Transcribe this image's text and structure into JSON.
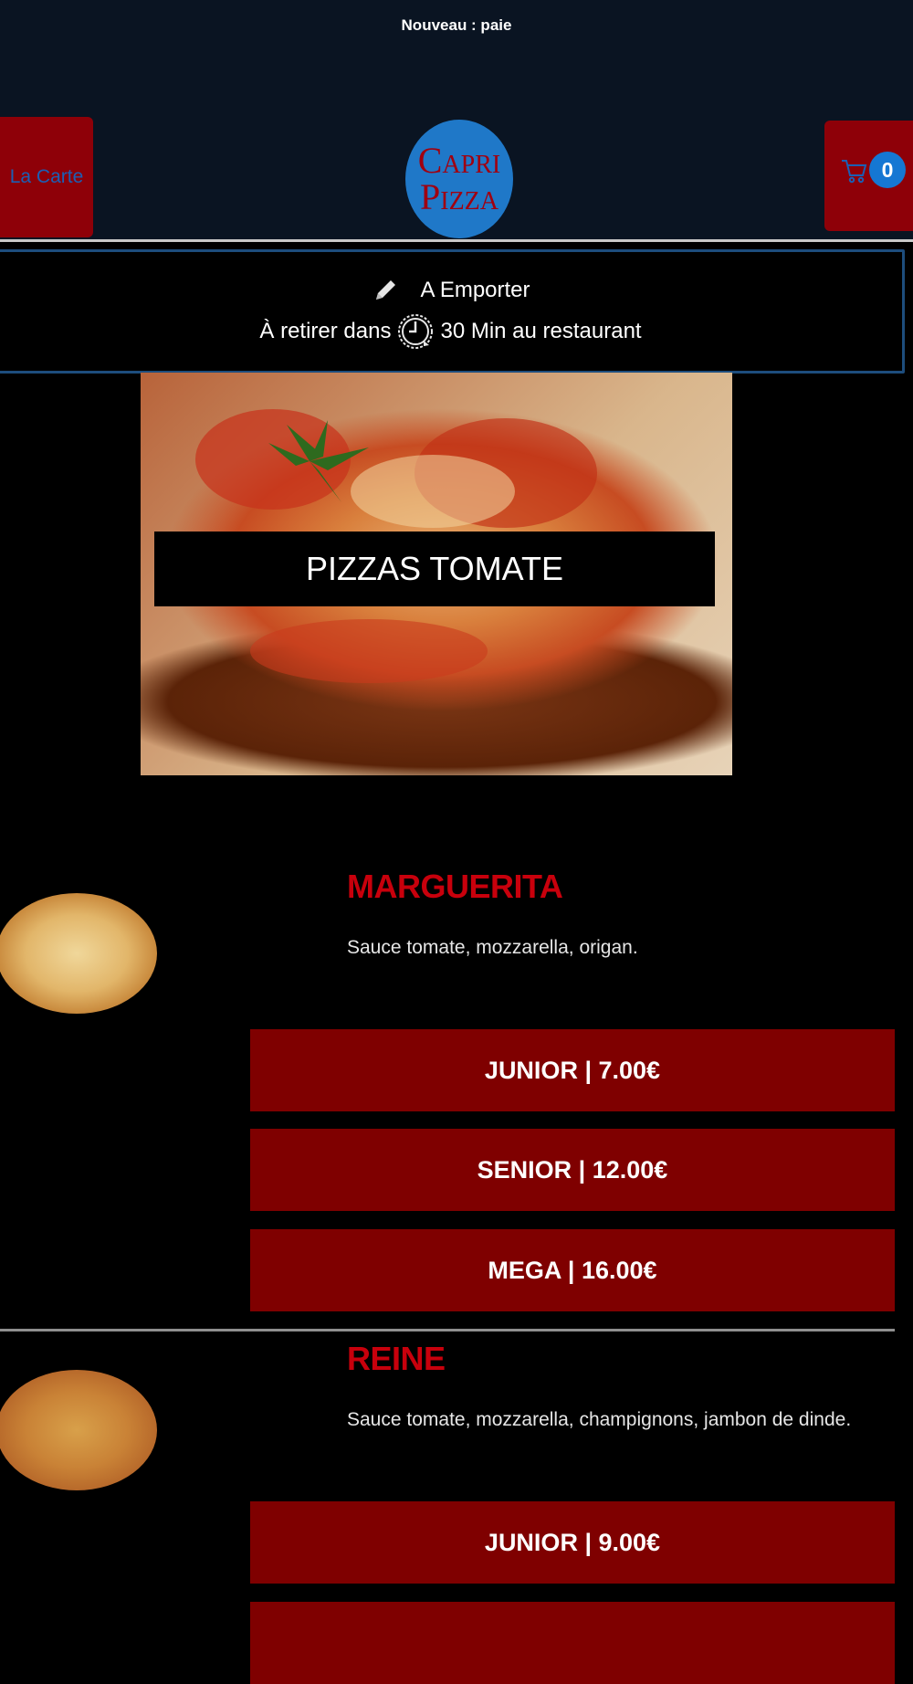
{
  "announcement": "Nouveau : paie",
  "nav": {
    "menu_label": "La Carte",
    "logo_line1": "Capri",
    "logo_line2": "Pizza",
    "cart_count": "0"
  },
  "order_mode": {
    "mode": "A Emporter",
    "pickup_prefix": "À retirer dans",
    "pickup_suffix": "30 Min au restaurant"
  },
  "category": {
    "title": "PIZZAS TOMATE"
  },
  "items": [
    {
      "name": "MARGUERITA",
      "description": "Sauce tomate, mozzarella, origan.",
      "sizes": [
        "JUNIOR | 7.00€",
        "SENIOR | 12.00€",
        "MEGA | 16.00€"
      ]
    },
    {
      "name": "REINE",
      "description": "Sauce tomate, mozzarella, champignons, jambon de dinde.",
      "sizes": [
        "JUNIOR | 9.00€",
        ""
      ]
    }
  ],
  "colors": {
    "header_bg": "#0a1422",
    "accent_red": "#8e0008",
    "price_button": "#7f0000",
    "item_title": "#c8000c",
    "badge_blue": "#1577d3"
  }
}
